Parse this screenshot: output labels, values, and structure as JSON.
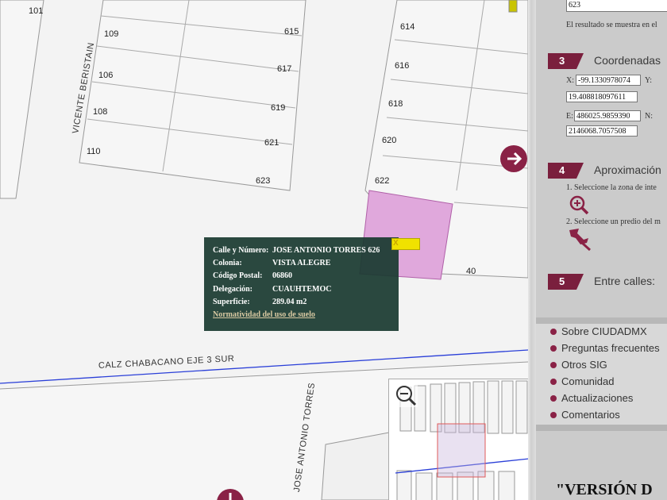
{
  "map": {
    "lot_numbers": [
      "101",
      "109",
      "106",
      "108",
      "110",
      "615",
      "617",
      "619",
      "621",
      "623",
      "614",
      "616",
      "618",
      "620",
      "622",
      "40"
    ],
    "streets": {
      "vicente": "VICENTE BERISTAIN",
      "calz": "CALZ CHABACANO EJE 3 SUR",
      "jose": "JOSE ANTONIO TORRES"
    },
    "popup": {
      "rows": [
        {
          "label": "Calle y Número:",
          "value": "JOSE ANTONIO TORRES 626"
        },
        {
          "label": "Colonia:",
          "value": "VISTA ALEGRE"
        },
        {
          "label": "Código Postal:",
          "value": "06860"
        },
        {
          "label": "Delegación:",
          "value": "CUAUHTEMOC"
        },
        {
          "label": "Superficie:",
          "value": "289.04 m2"
        }
      ],
      "link": "Normatividad del uso de suelo",
      "close": "X"
    },
    "colors": {
      "selected_parcel": "#e0a8dc",
      "popup_bg": "#1a3a30",
      "blue_street": "#2a3fd8"
    }
  },
  "panel": {
    "number_value": "623",
    "result_note": "El resultado se muestra en el",
    "steps": [
      {
        "num": "3",
        "title": "Coordenadas"
      },
      {
        "num": "4",
        "title": "Aproximación"
      },
      {
        "num": "5",
        "title": "Entre calles:"
      }
    ],
    "coords": {
      "x_label": "X:",
      "x_value": "-99.1330978074",
      "y_label": "Y:",
      "y_value": "19.408818097611",
      "e_label": "E:",
      "e_value": "486025.9859390",
      "n_label": "N:",
      "n_value": "2146068.7057508"
    },
    "approx": {
      "step1": "1. Seleccione la zona de inte",
      "step2": "2. Seleccione un predio del m"
    },
    "menu": [
      "Sobre CIUDADMX",
      "Preguntas frecuentes",
      "Otros SIG",
      "Comunidad",
      "Actualizaciones",
      "Comentarios"
    ],
    "version": "\"VERSIÓN D",
    "accent": "#7a1f3d"
  }
}
